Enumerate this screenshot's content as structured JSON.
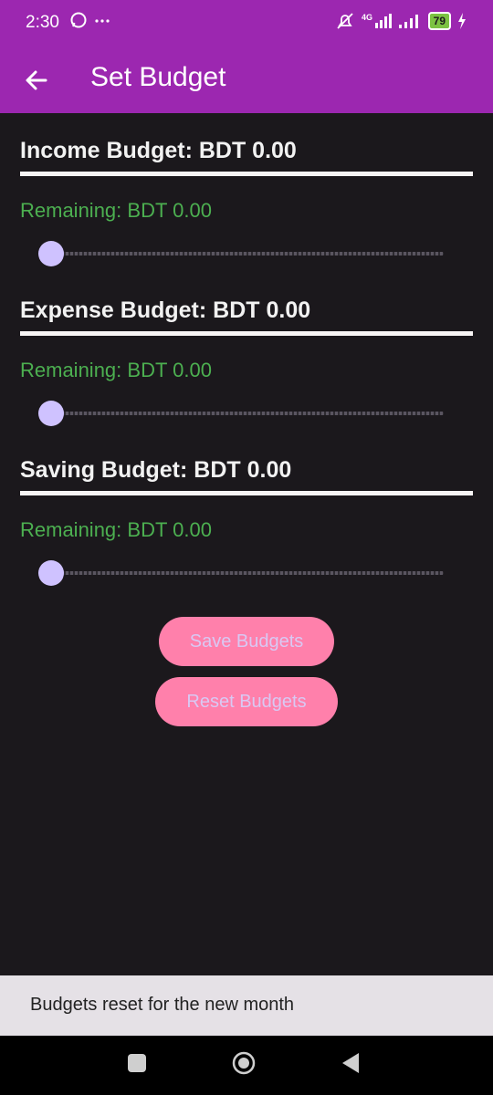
{
  "status_bar": {
    "time": "2:30",
    "left_icons": [
      "whatsapp-icon",
      "more-dots-icon"
    ],
    "right_icons": [
      "muted-bell-icon",
      "4g-signal-icon",
      "signal-icon",
      "battery-icon",
      "charging-icon"
    ],
    "network": "4G",
    "battery": "79"
  },
  "app_bar": {
    "title": "Set Budget",
    "background": "#9c27b0"
  },
  "budgets": [
    {
      "title": "Income Budget: BDT 0.00",
      "remaining": "Remaining: BDT 0.00",
      "slider_value": 0
    },
    {
      "title": "Expense Budget: BDT 0.00",
      "remaining": "Remaining: BDT 0.00",
      "slider_value": 0
    },
    {
      "title": "Saving Budget: BDT 0.00",
      "remaining": "Remaining: BDT 0.00",
      "slider_value": 0
    }
  ],
  "buttons": {
    "save": "Save Budgets",
    "reset": "Reset Budgets"
  },
  "snackbar": {
    "message": "Budgets reset for the new month"
  },
  "colors": {
    "accent": "#9c27b0",
    "remaining_text": "#4caf50",
    "button_bg": "#ff80ab",
    "slider_thumb": "#cfc2ff",
    "background": "#1b181c"
  }
}
